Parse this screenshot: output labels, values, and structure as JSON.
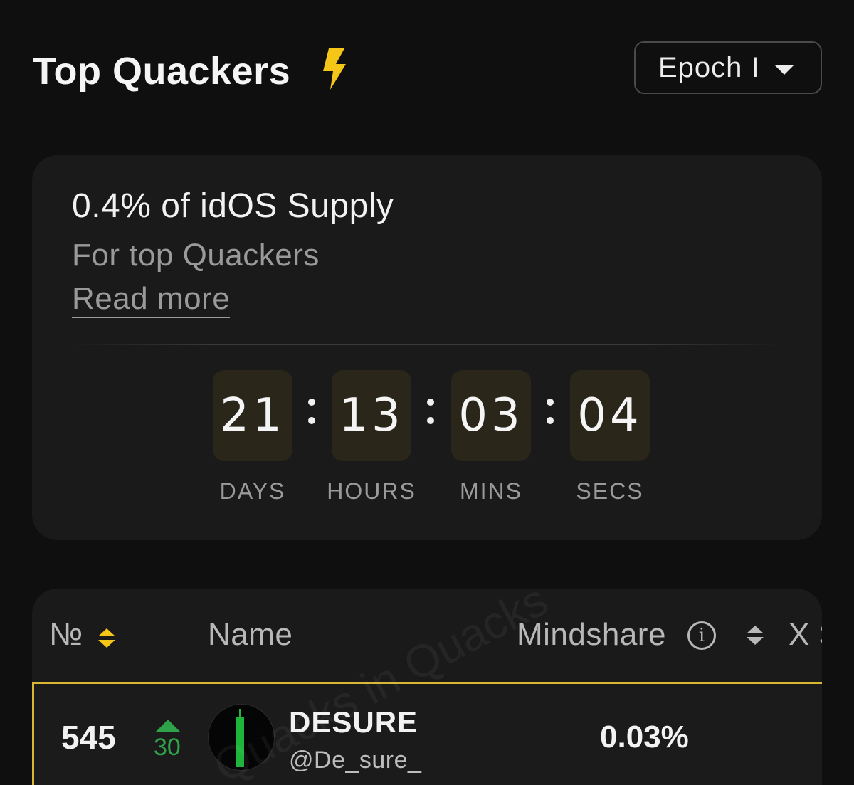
{
  "header": {
    "title": "Top Quackers",
    "title_icon": "lightning-bolt-icon",
    "epoch_select": {
      "selected": "Epoch I",
      "icon": "caret-down-icon"
    }
  },
  "reward_card": {
    "title": "0.4% of idOS Supply",
    "subtitle": "For top Quackers",
    "read_more": "Read more",
    "countdown": {
      "days": "21",
      "hours": "13",
      "mins": "03",
      "secs": "04",
      "separator": ":",
      "labels": {
        "days": "DAYS",
        "hours": "HOURS",
        "mins": "MINS",
        "secs": "SECS"
      }
    }
  },
  "leaderboard": {
    "columns": {
      "rank": "№",
      "name": "Name",
      "mindshare": "Mindshare",
      "x_partial": "X S"
    },
    "rows": [
      {
        "rank": "545",
        "rank_change": "30",
        "rank_change_direction": "up",
        "name": "DESURE",
        "handle": "@De_sure_",
        "mindshare": "0.03%",
        "avatar_icon": "green-candle-avatar-icon"
      }
    ],
    "watermark": "Quacks  in Quacks"
  },
  "colors": {
    "background": "#0f0f0f",
    "card": "#1a1a1a",
    "accent_yellow": "#f5c518",
    "highlight_border": "#d8b832",
    "positive_green": "#2fa34a",
    "countdown_box": "#2a2619"
  }
}
